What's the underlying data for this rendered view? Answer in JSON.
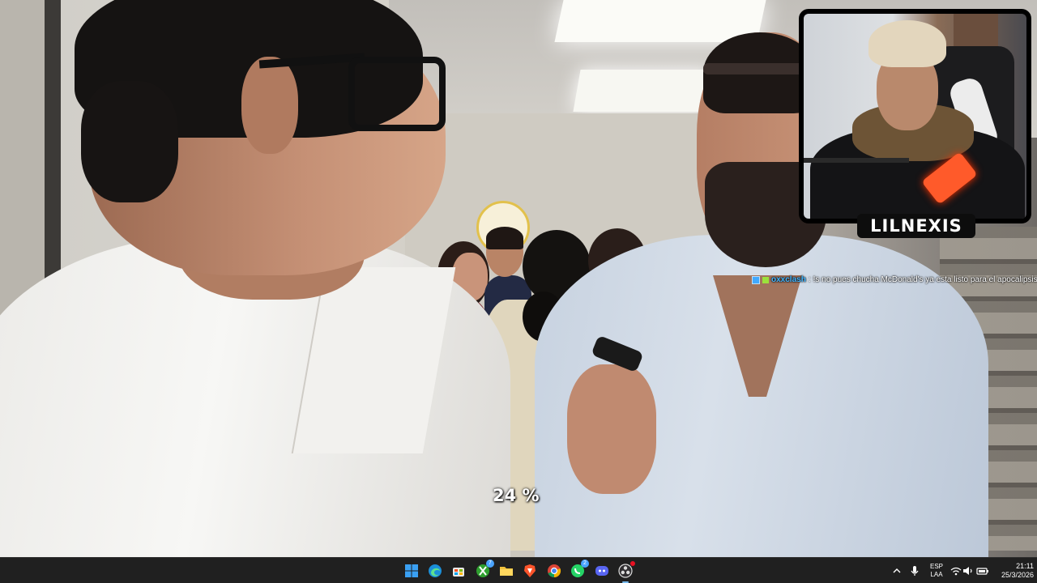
{
  "overlay": {
    "streamer_name": "LILNEXIS",
    "progress_text": "24 %",
    "chat": {
      "username": "oxxclash",
      "separator": ":",
      "message": "!s no pues chucha McDonald's ya esta listo para el apocalipsis loco"
    }
  },
  "taskbar": {
    "icons": [
      {
        "name": "windows-start-icon",
        "badge": null
      },
      {
        "name": "edge-icon",
        "badge": null
      },
      {
        "name": "store-icon",
        "badge": null
      },
      {
        "name": "xbox-icon",
        "badge": "7"
      },
      {
        "name": "file-explorer-icon",
        "badge": null
      },
      {
        "name": "brave-icon",
        "badge": null
      },
      {
        "name": "chrome-icon",
        "badge": null
      },
      {
        "name": "whatsapp-icon",
        "badge": "2"
      },
      {
        "name": "discord-icon",
        "badge": null
      },
      {
        "name": "obs-icon",
        "badge": ""
      }
    ],
    "tray": {
      "language_line1": "ESP",
      "language_line2": "LAA",
      "time": "21:11",
      "date": "25/3/2026"
    }
  },
  "colors": {
    "taskbar_bg": "#202020",
    "chat_user": "#3fb4ff",
    "accent": "#76b9ed"
  }
}
